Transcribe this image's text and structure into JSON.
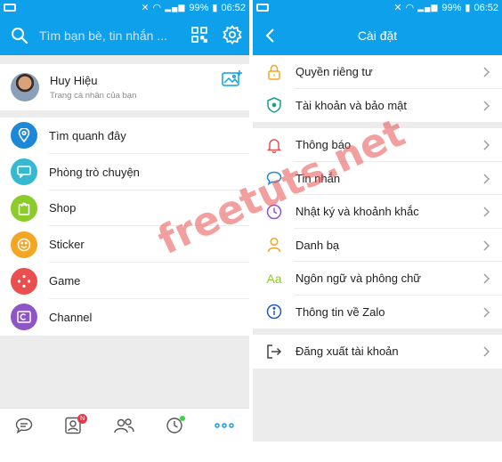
{
  "status_bar": {
    "battery": "99%",
    "time": "06:52"
  },
  "left": {
    "search_placeholder": "Tìm bạn bè, tin nhắn ...",
    "profile": {
      "name": "Huy Hiệu",
      "subtitle": "Trang cá nhân của bạn"
    },
    "menu": [
      {
        "label": "Tìm quanh đây",
        "icon": "location-pin-icon",
        "color": "#1e88d8"
      },
      {
        "label": "Phòng trò chuyện",
        "icon": "chat-room-icon",
        "color": "#35b8d2"
      },
      {
        "label": "Shop",
        "icon": "shopping-bag-icon",
        "color": "#8ccc2a"
      },
      {
        "label": "Sticker",
        "icon": "smiley-icon",
        "color": "#f2a623"
      },
      {
        "label": "Game",
        "icon": "gamepad-icon",
        "color": "#e94f4f"
      },
      {
        "label": "Channel",
        "icon": "channel-icon",
        "color": "#8e55c8"
      }
    ],
    "bottom_nav": {
      "contacts_badge": "N"
    }
  },
  "right": {
    "title": "Cài đặt",
    "groups": [
      [
        {
          "label": "Quyền riêng tư",
          "icon": "lock-icon"
        },
        {
          "label": "Tài khoản và bảo mật",
          "icon": "shield-icon"
        }
      ],
      [
        {
          "label": "Thông báo",
          "icon": "bell-icon"
        },
        {
          "label": "Tin nhắn",
          "icon": "message-icon"
        },
        {
          "label": "Nhật ký và khoảnh khắc",
          "icon": "clock-icon"
        },
        {
          "label": "Danh bạ",
          "icon": "person-icon"
        },
        {
          "label": "Ngôn ngữ và phông chữ",
          "icon": "font-icon"
        },
        {
          "label": "Thông tin về Zalo",
          "icon": "info-icon"
        }
      ],
      [
        {
          "label": "Đăng xuất tài khoản",
          "icon": "logout-icon"
        }
      ]
    ]
  },
  "watermark": "freetuts.net",
  "colors": {
    "primary": "#0fa0ec",
    "background": "#ececec"
  }
}
